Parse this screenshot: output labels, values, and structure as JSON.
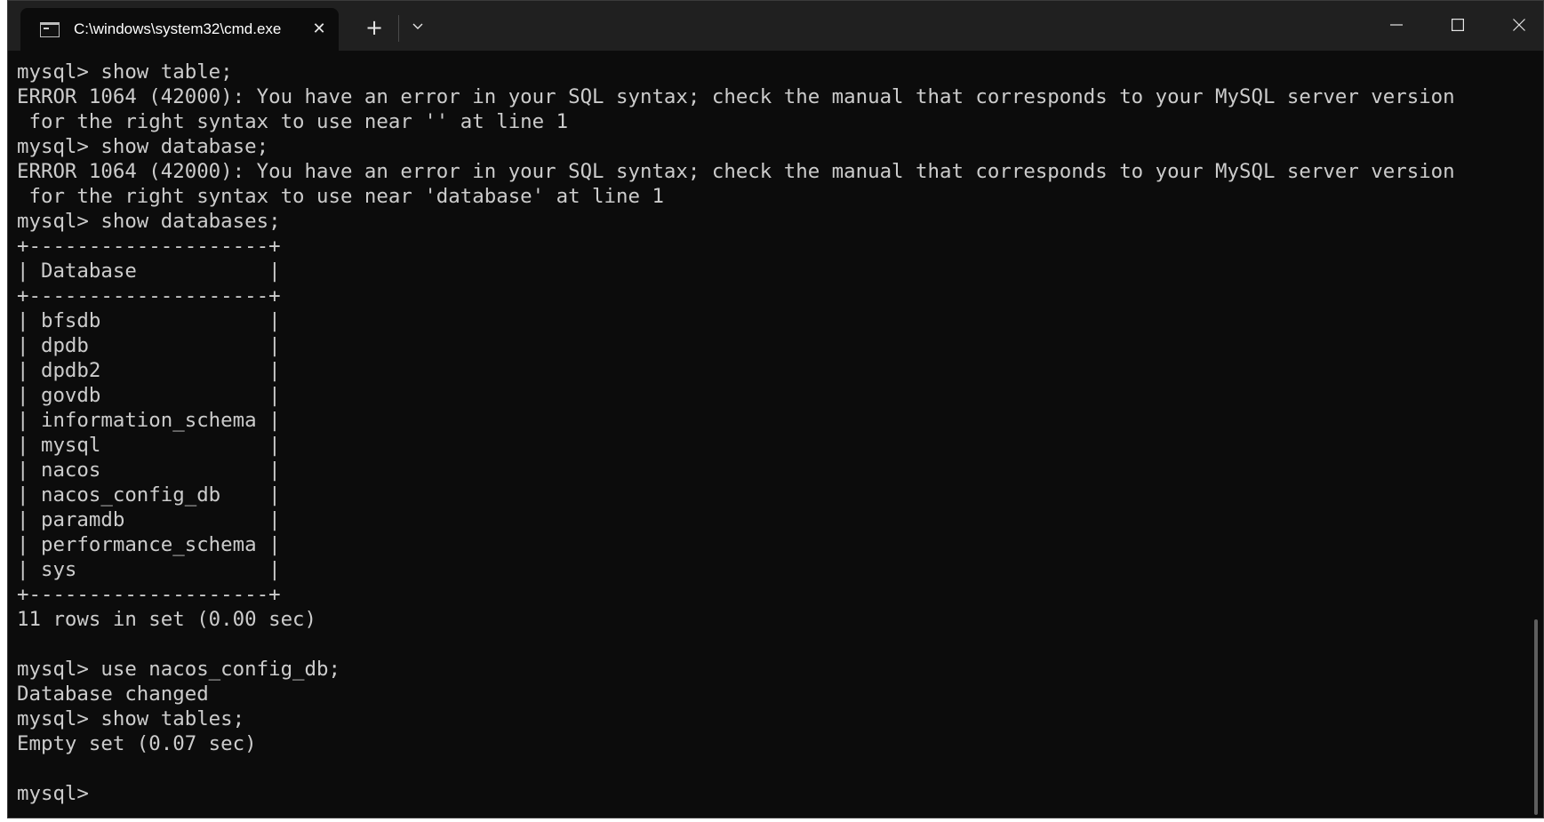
{
  "window": {
    "tab_title": "C:\\windows\\system32\\cmd.exe",
    "tab_close_glyph": "✕",
    "new_tab_glyph": "+",
    "icons": {
      "terminal": "cmd-terminal-icon",
      "close": "close-icon",
      "new_tab": "plus-icon",
      "dropdown": "chevron-down-icon",
      "minimize": "minimize-icon",
      "maximize": "maximize-icon",
      "window_close": "close-icon"
    },
    "colors": {
      "terminal_bg": "#0c0c0c",
      "terminal_text": "#cccccc",
      "titlebar_bg": "#202020",
      "tab_bg": "#0c0c0c"
    }
  },
  "terminal": {
    "lines": [
      "mysql> show table;",
      "ERROR 1064 (42000): You have an error in your SQL syntax; check the manual that corresponds to your MySQL server version",
      " for the right syntax to use near '' at line 1",
      "mysql> show database;",
      "ERROR 1064 (42000): You have an error in your SQL syntax; check the manual that corresponds to your MySQL server version",
      " for the right syntax to use near 'database' at line 1",
      "mysql> show databases;",
      "+--------------------+",
      "| Database           |",
      "+--------------------+",
      "| bfsdb              |",
      "| dpdb               |",
      "| dpdb2              |",
      "| govdb              |",
      "| information_schema |",
      "| mysql              |",
      "| nacos              |",
      "| nacos_config_db    |",
      "| paramdb            |",
      "| performance_schema |",
      "| sys                |",
      "+--------------------+",
      "11 rows in set (0.00 sec)",
      "",
      "mysql> use nacos_config_db;",
      "Database changed",
      "mysql> show tables;",
      "Empty set (0.07 sec)",
      "",
      "mysql> "
    ]
  }
}
